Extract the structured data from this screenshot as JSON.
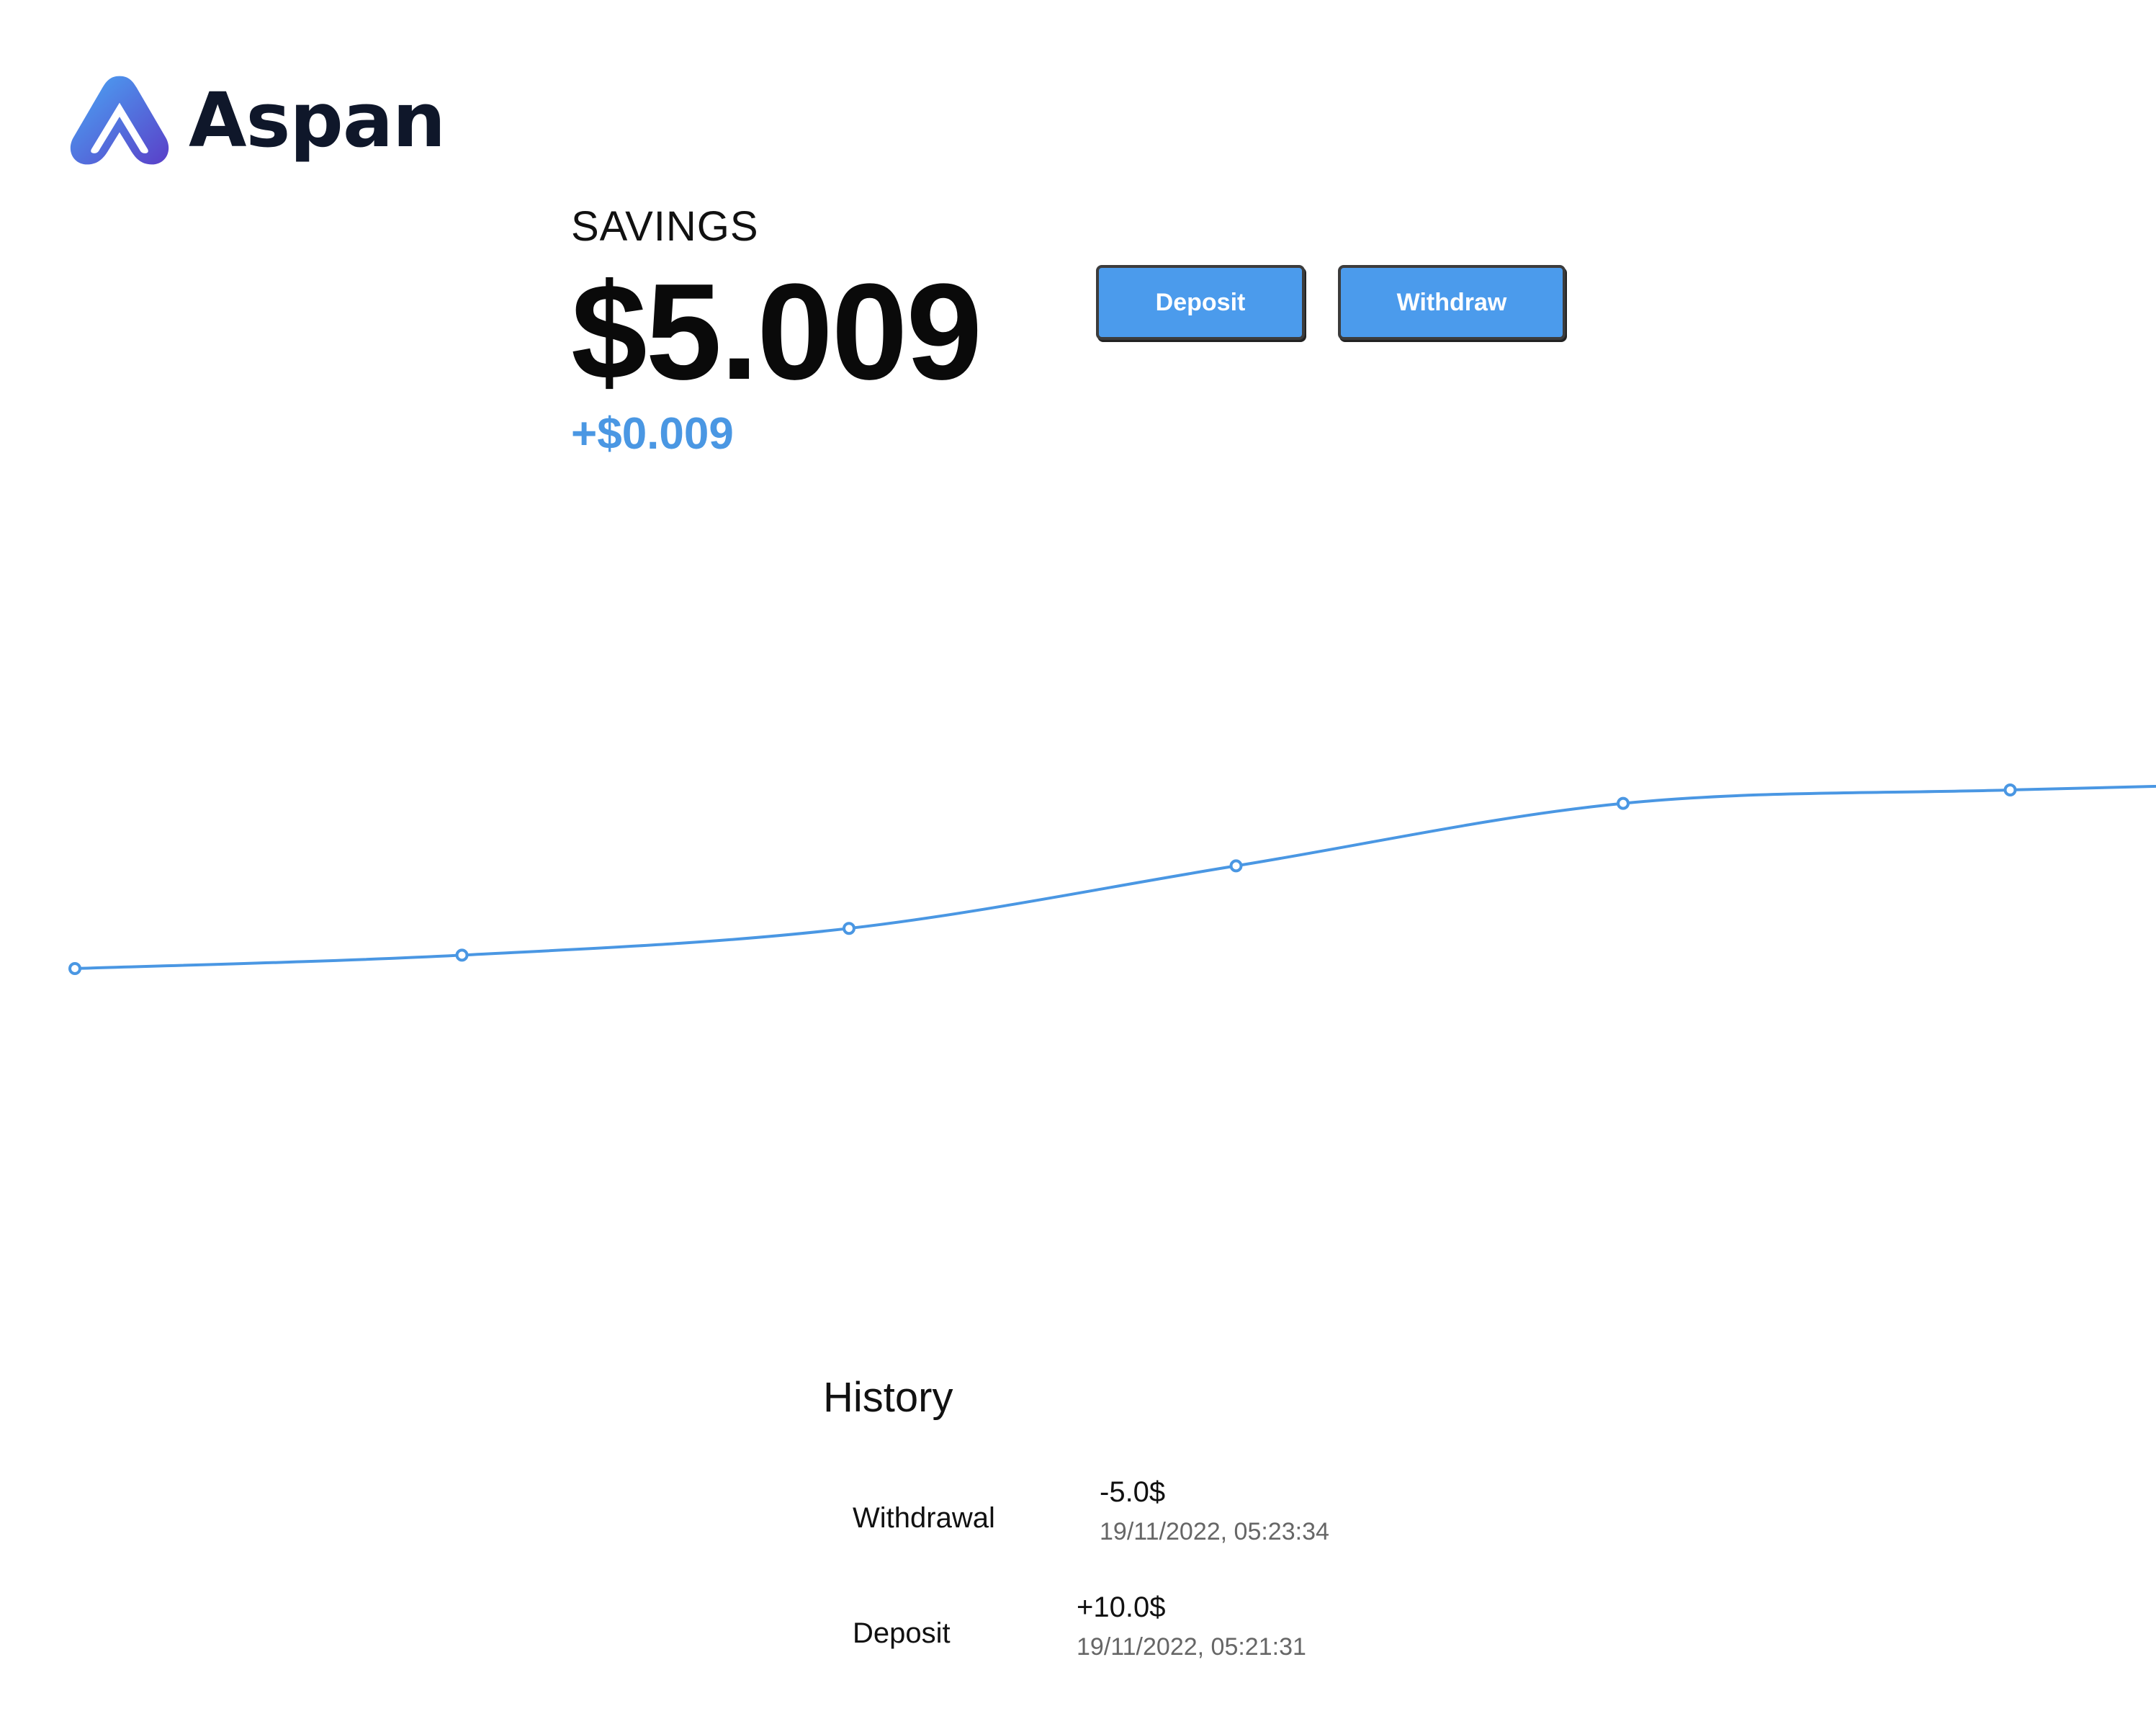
{
  "brand": {
    "name": "Aspan",
    "logo_icon": "aspan-logo-icon"
  },
  "account": {
    "label": "SAVINGS",
    "balance": "$5.009",
    "change": "+$0.009"
  },
  "actions": {
    "deposit_label": "Deposit",
    "withdraw_label": "Withdraw"
  },
  "colors": {
    "accent": "#4a97e3",
    "button": "#4b9bec",
    "text": "#0a0a0a"
  },
  "chart_data": {
    "type": "line",
    "title": "",
    "xlabel": "",
    "ylabel": "",
    "grid": false,
    "legend": "none",
    "x": [
      0,
      1,
      2,
      3,
      4,
      5,
      6
    ],
    "ylim": [
      0,
      1
    ],
    "series": [
      {
        "values": [
          0.25,
          0.28,
          0.34,
          0.48,
          0.62,
          0.65,
          0.67
        ],
        "color": "#4a97e3"
      }
    ]
  },
  "history": {
    "title": "History",
    "items": [
      {
        "type": "Withdrawal",
        "amount": "-5.0$",
        "timestamp": "19/11/2022, 05:23:34"
      },
      {
        "type": "Deposit",
        "amount": "+10.0$",
        "timestamp": "19/11/2022, 05:21:31"
      }
    ]
  }
}
